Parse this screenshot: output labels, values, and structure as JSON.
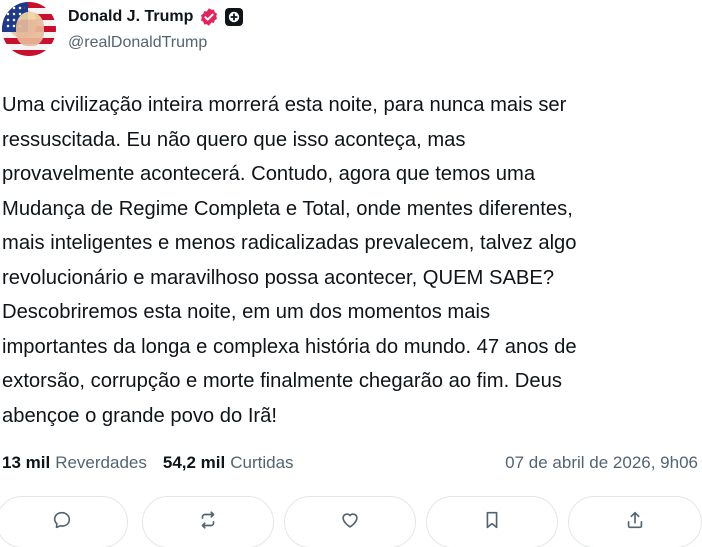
{
  "author": {
    "display_name": "Donald J. Trump",
    "handle": "@realDonaldTrump",
    "verified_color": "#e0245e"
  },
  "post": {
    "lines": [
      "Uma civilização inteira morrerá esta noite, para nunca mais ser",
      "ressuscitada. Eu não quero que isso aconteça, mas",
      "provavelmente acontecerá. Contudo, agora que temos uma",
      "Mudança de Regime Completa e Total, onde mentes diferentes,",
      "mais inteligentes e menos radicalizadas prevalecem, talvez algo",
      "revolucionário e maravilhoso possa acontecer, QUEM SABE?",
      "Descobriremos esta noite, em um dos momentos mais",
      "importantes da longa e complexa história do mundo. 47 anos de",
      "extorsão, corrupção e morte finalmente chegarão ao fim. Deus",
      "abençoe o grande povo do Irã!"
    ]
  },
  "stats": {
    "reposts_count": "13 mil",
    "reposts_label": "Reverdades",
    "likes_count": "54,2 mil",
    "likes_label": "Curtidas",
    "timestamp": "07 de abril de 2026, 9h06"
  },
  "actions": [
    {
      "name": "reply-button",
      "icon": "comment-icon"
    },
    {
      "name": "repost-button",
      "icon": "repost-icon"
    },
    {
      "name": "like-button",
      "icon": "heart-icon"
    },
    {
      "name": "bookmark-button",
      "icon": "bookmark-icon"
    },
    {
      "name": "share-button",
      "icon": "share-icon"
    }
  ],
  "colors": {
    "text": "#0f1419",
    "muted": "#536471",
    "border": "#e4e6e8"
  }
}
